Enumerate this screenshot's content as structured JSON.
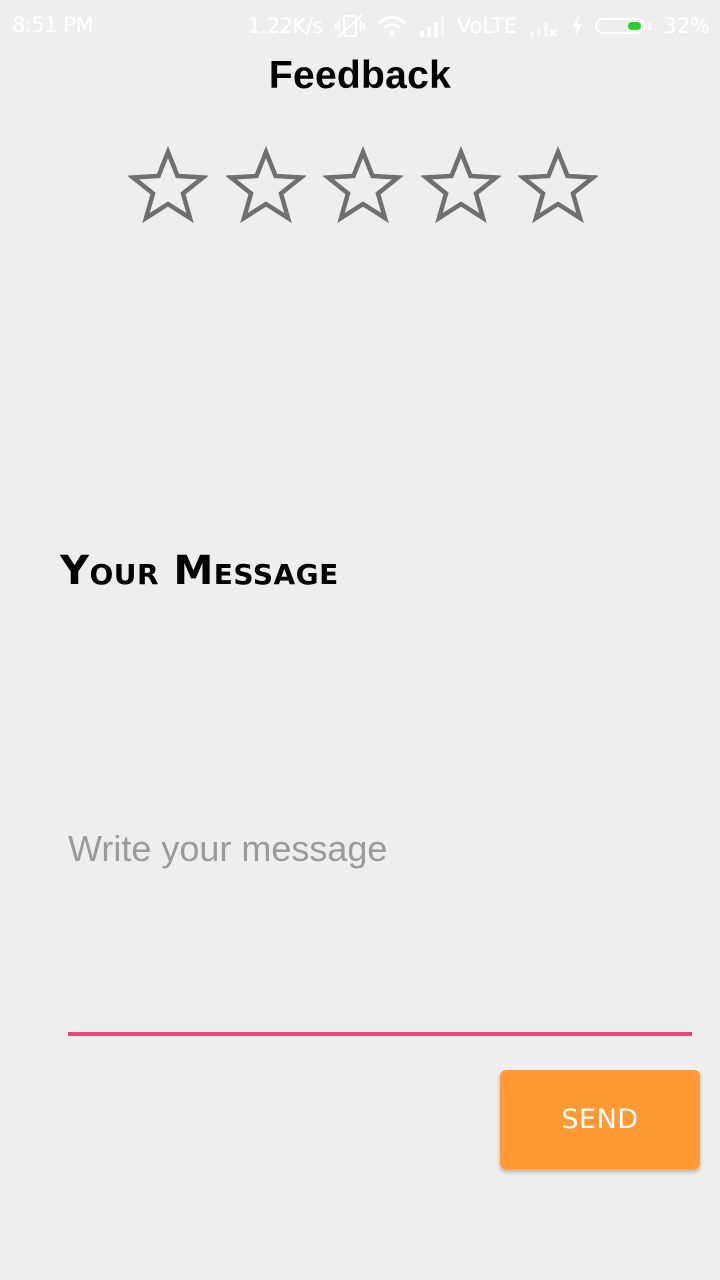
{
  "status_bar": {
    "time": "8:51 PM",
    "network_speed": "1.22K/s",
    "network_type": "VoLTE",
    "battery_percent": "32%",
    "battery_level": 0.32,
    "icons": [
      "vibrate-off-icon",
      "wifi-icon",
      "signal-icon",
      "signal-no-service-icon",
      "charging-icon",
      "battery-icon"
    ]
  },
  "header": {
    "title": "Feedback"
  },
  "rating": {
    "max_stars": 5,
    "selected": 0,
    "star_icon": "star-outline-icon",
    "star_color": "#6f6f6f"
  },
  "message": {
    "label": "Your Message",
    "input_value": "",
    "placeholder": "Write your message",
    "underline_color": "#e8487a"
  },
  "actions": {
    "send_label": "SEND",
    "send_color": "#ff9933"
  }
}
